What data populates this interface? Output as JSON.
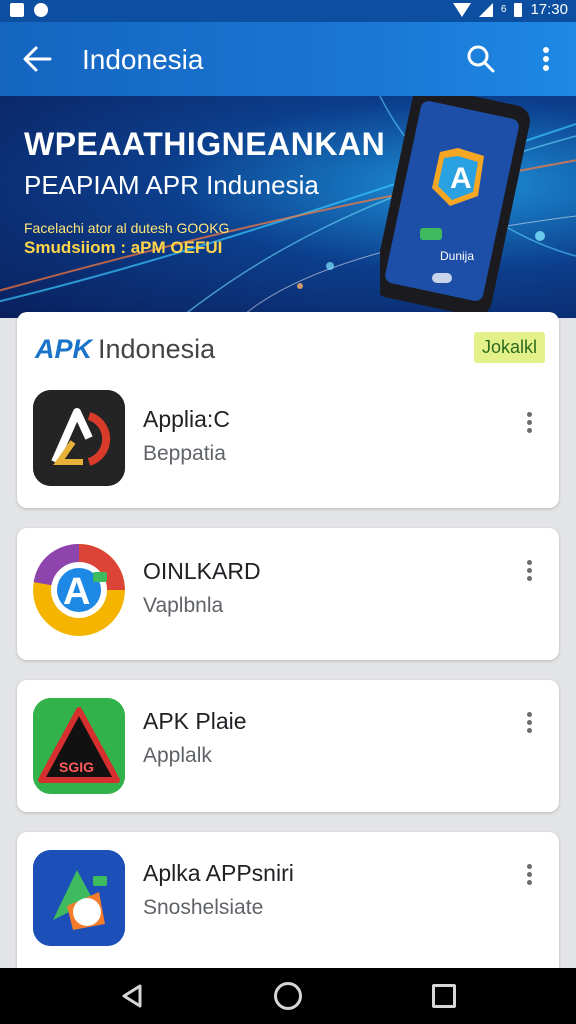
{
  "status_bar": {
    "time": "17:30",
    "small_label": "6"
  },
  "app_bar": {
    "title": "Indonesia"
  },
  "banner": {
    "title_line1": "WPEAATHIGNEANKAN",
    "title_line2": "PEAPIAM APR Indunesia",
    "sub_line1": "Facelachi ator al dutesh GOOKG",
    "sub_line2": "Smudsiiom : aPM OEFUI",
    "phone_label": "Dunija"
  },
  "card_header": {
    "brand": "APK",
    "title": "Indonesia",
    "tag": "Jokalkl"
  },
  "apps": [
    {
      "name": "Applia:C",
      "subtitle": "Beppatia",
      "icon": "app-icon-a-red"
    },
    {
      "name": "OINLKARD",
      "subtitle": "Vaplbnla",
      "icon": "app-icon-a-chrome"
    },
    {
      "name": "APK Plaie",
      "subtitle": "Applalk",
      "icon": "app-icon-warning-green",
      "icon_text": "SGIG"
    },
    {
      "name": "Aplka APPsniri",
      "subtitle": "Snoshelsiate",
      "icon": "app-icon-a-blue"
    }
  ],
  "colors": {
    "app_bar": "#1976d2",
    "status_bar": "#0c4fa0",
    "tag_bg": "#e4f08a",
    "nav_bar": "#000000"
  }
}
